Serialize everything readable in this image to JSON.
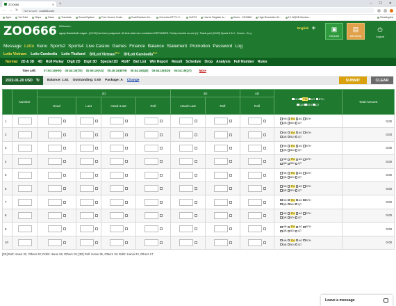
{
  "browser": {
    "tab_title": "ZOO666",
    "url_security": "Not secure",
    "url": "zoo666.com",
    "bookmarks": [
      "Apps",
      "YouTube",
      "Maps",
      "News",
      "Translate",
      "ScoresSystem",
      "Free Source Code...",
      "CodeRandom Cu...",
      "Overview EP TX C...",
      "GoF33",
      "How to Register to...",
      "Home - ZOO666",
      "High Resolution M...",
      "1X WQHD Monitor...",
      "Reading list"
    ]
  },
  "header": {
    "logo": "ZOO666",
    "welcome": "Welcome,",
    "ticker": "aguay Basketball League - [01/19] has been postponed. All bets taken are considered REFUNDED. Parlay counted as one (1). Thank you!    [01/20] Sports 2 & 4 - Soccer - Ile-y",
    "lang_en": "English",
    "lang_cn": "中",
    "deposit": "Deposit",
    "withdraw": "Withdraw",
    "logout": "Logout"
  },
  "mainnav": [
    "Message",
    "Lotto",
    "Keno",
    "Sports2",
    "Sports4",
    "Live Casino",
    "Games",
    "Finance",
    "Balance",
    "Statement",
    "Promotion",
    "Password",
    "Log"
  ],
  "mainnav_active": "Lotto",
  "subnav": [
    {
      "label": "Lotto Vietnam",
      "sup": ""
    },
    {
      "label": "Lotto Cambodia",
      "sup": ""
    },
    {
      "label": "Lotto Thailand",
      "sup": ""
    },
    {
      "label": "SHLott Vietnam",
      "sup": "New"
    },
    {
      "label": "SHLott Cambodia",
      "sup": "New"
    }
  ],
  "gamenav": [
    "Normal",
    "2D & 3D",
    "4D",
    "Roll Parlay",
    "Digit 2D",
    "Digit 3D",
    "Special 2D",
    "Roll7",
    "Bet List",
    "Win Report",
    "Result",
    "Schedule",
    "Drop",
    "Analysis",
    "Full Number",
    "Rules"
  ],
  "timeleft": {
    "label": "Time Left:",
    "times": [
      "07:50:19(HN)",
      "05:54:19(TN)",
      "05:59:19(AG)",
      "05:49:19(BTH)",
      "05:54:19(QB)",
      "05:54:19(BDI)",
      "05:54:19(QT)"
    ],
    "more": "More"
  },
  "toolbar": {
    "date": "2022-01-20 USD",
    "balance": "Balance: 1.51",
    "outstanding": "Outstanding: 0.00",
    "package": "Package: A",
    "change": "Change",
    "submit": "SUBMIT",
    "clear": "CLEAR"
  },
  "table": {
    "groups": {
      "d2": "2D",
      "d3": "3D",
      "d4": "4D"
    },
    "cols": [
      "Number",
      "Head",
      "Last",
      "Head+Last",
      "Roll",
      "Head+Last",
      "Roll",
      "Roll",
      "Total Amount"
    ],
    "providers_header": [
      "HN",
      "TN",
      "AG",
      "BTH",
      "QB",
      "BDI",
      "QT"
    ],
    "providers_row": [
      "HN",
      "TN",
      "AG",
      "BTH",
      "QB",
      "BDI",
      "QT"
    ],
    "rows": [
      "1",
      "2",
      "3",
      "4",
      "5",
      "6",
      "7",
      "8",
      "9",
      "10"
    ],
    "amount": "0.00"
  },
  "remarks": "[2D] Roll: Hanoi 32, Others 22; Roll2: Hanoi 28, Others 19; [3D] Roll: Hanoi 25, Others 19; Roll2: Hanoi 23, Others 17",
  "chat": "Leave a message"
}
